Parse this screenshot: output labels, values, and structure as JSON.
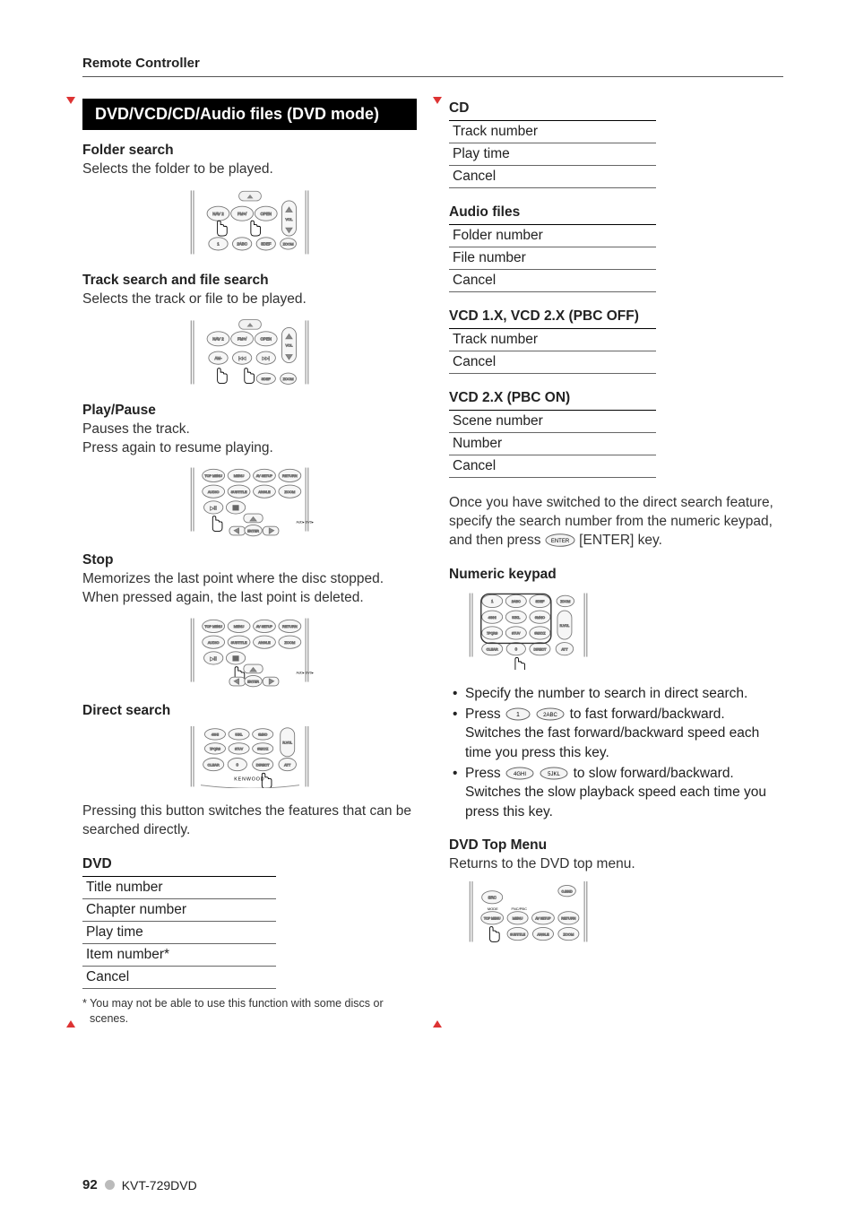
{
  "running_head": "Remote Controller",
  "black_band": "DVD/VCD/CD/Audio files (DVD mode)",
  "left": {
    "folder_search": {
      "title": "Folder search",
      "body": "Selects the folder to be played."
    },
    "track_search": {
      "title": "Track search and file search",
      "body": "Selects the track or file to be played."
    },
    "play_pause": {
      "title": "Play/Pause",
      "line1": "Pauses the track.",
      "line2": "Press again to resume playing."
    },
    "stop": {
      "title": "Stop",
      "line1": "Memorizes the last point where the disc stopped.",
      "line2": "When pressed again, the last point is deleted."
    },
    "direct_search": {
      "title": "Direct search",
      "body": "Pressing this button switches the features that can be searched directly."
    },
    "dvd": {
      "title": "DVD",
      "rows": [
        "Title number",
        "Chapter number",
        "Play time",
        "Item number*",
        "Cancel"
      ],
      "footnote": "* You may not be able to use this function with some discs or scenes."
    }
  },
  "right": {
    "cd": {
      "title": "CD",
      "rows": [
        "Track number",
        "Play time",
        "Cancel"
      ]
    },
    "audio_files": {
      "title": "Audio files",
      "rows": [
        "Folder number",
        "File number",
        "Cancel"
      ]
    },
    "vcd_pbc_off": {
      "title": "VCD 1.X, VCD 2.X (PBC OFF)",
      "rows": [
        "Track number",
        "Cancel"
      ]
    },
    "vcd_pbc_on": {
      "title": "VCD 2.X (PBC ON)",
      "rows": [
        "Scene number",
        "Number",
        "Cancel"
      ]
    },
    "direct_instruction": {
      "body": "Once you have switched to the direct search feature, specify the search number from the numeric keypad, and then press ",
      "key_label": "ENTER",
      "body_tail": " [ENTER] key."
    },
    "numeric_keypad": {
      "title": "Numeric keypad",
      "bullets": [
        {
          "text": "Specify the number to search in direct search."
        },
        {
          "pre": "Press ",
          "keys": [
            "1",
            "2ABC"
          ],
          "post": " to fast forward/backward. Switches the fast forward/backward speed each time you press this key."
        },
        {
          "pre": "Press ",
          "keys": [
            "4GHI",
            "5JKL"
          ],
          "post": " to slow forward/backward. Switches the slow playback speed each time you press this key."
        }
      ]
    },
    "dvd_top_menu": {
      "title": "DVD Top Menu",
      "body": "Returns to the DVD top menu."
    }
  },
  "footer": {
    "page": "92",
    "model": "KVT-729DVD"
  },
  "key_labels": {
    "nav2": "NAV 2",
    "fm_plus": "FM+/",
    "mode": "MODE",
    "fnc_pbc": "FNC/PBC",
    "src": "SRC",
    "obind": "O.BIND",
    "vol": "VOL",
    "top_menu": "TOP MENU",
    "menu": "MENU",
    "av_setup": "AV SETUP",
    "return": "RETURN",
    "audio": "AUDIO",
    "subtitle": "SUBTITLE",
    "angle": "ANGLE",
    "zoom": "ZOOM",
    "enter": "ENTER",
    "aud_dvd_tv": "AUD▸ DVD▸ TV▸",
    "k1": "1",
    "k2": "2ABC",
    "k3": "3DEF",
    "k4": "4GHI",
    "k5": "5JKL",
    "k6": "6MNO",
    "k7": "7PQRS",
    "k8": "8TUV",
    "k9": "9WXYZ",
    "k0": "0",
    "clear": "CLEAR",
    "direct": "DIRECT",
    "att": "ATT",
    "rvol": "R.VOL",
    "logo": "KENWOOD"
  }
}
